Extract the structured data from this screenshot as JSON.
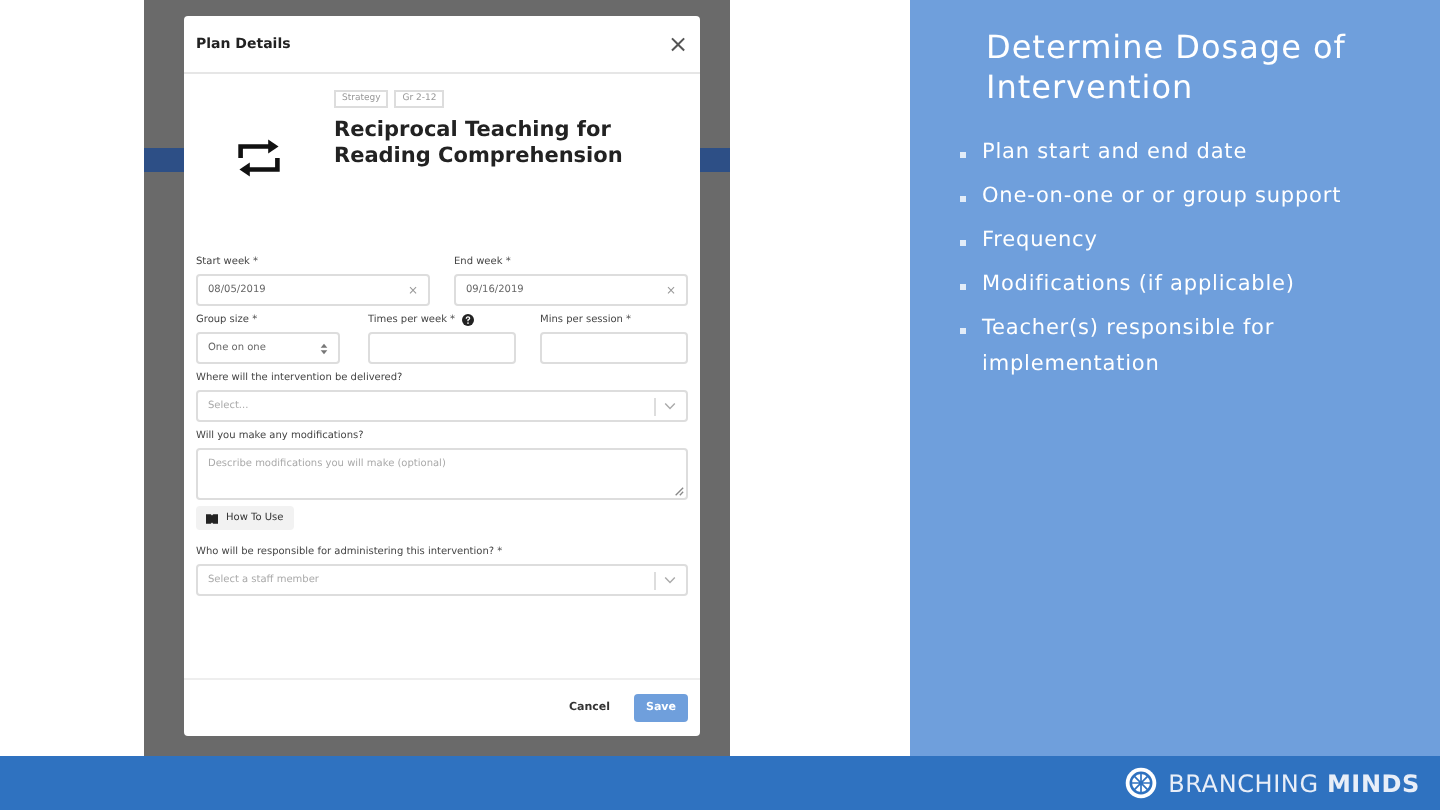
{
  "modal": {
    "title": "Plan Details",
    "close": "×",
    "tags": [
      {
        "label": "Strategy"
      },
      {
        "label": "Gr 2-12"
      }
    ],
    "heading": "Reciprocal Teaching for Reading Comprehension",
    "items": [
      {
        "kind": "fields",
        "fields": [
          {
            "label": "Start week *",
            "kind": "date",
            "value": "08/05/2019",
            "clear": "×"
          },
          {
            "label": "End week *",
            "kind": "date",
            "value": "09/16/2019",
            "clear": "×"
          }
        ]
      },
      {
        "kind": "fields",
        "fields": [
          {
            "label": "Group size *",
            "kind": "stepper",
            "value": "One on one"
          },
          {
            "label": "Times per week *",
            "kind": "input",
            "help": true
          },
          {
            "label": "Mins per session *",
            "kind": "input"
          }
        ]
      },
      {
        "kind": "fields",
        "fields": [
          {
            "label": "Where will the intervention be delivered?",
            "kind": "dropdown",
            "placeholder": "Select..."
          }
        ]
      },
      {
        "kind": "fields",
        "fields": [
          {
            "label": "Will you make any modifications?",
            "kind": "textarea",
            "placeholder": "Describe modifications you will make (optional)"
          }
        ]
      },
      {
        "kind": "guide",
        "label": "How To Use"
      },
      {
        "kind": "fields",
        "fields": [
          {
            "label": "Who will be responsible for administering this intervention? *",
            "kind": "dropdown",
            "placeholder": "Select a staff member"
          }
        ]
      }
    ],
    "buttons": [
      {
        "label": "Cancel",
        "kind": "secondary"
      },
      {
        "label": "Save",
        "kind": "primary"
      }
    ]
  },
  "slide": {
    "title": "Determine Dosage of Intervention",
    "bullets": [
      "Plan start and end date",
      "One-on-one or or group support",
      "Frequency",
      "Modifications (if applicable)",
      "Teacher(s) responsible for implementation"
    ],
    "logo": "BRANCHING **MINDS**"
  }
}
